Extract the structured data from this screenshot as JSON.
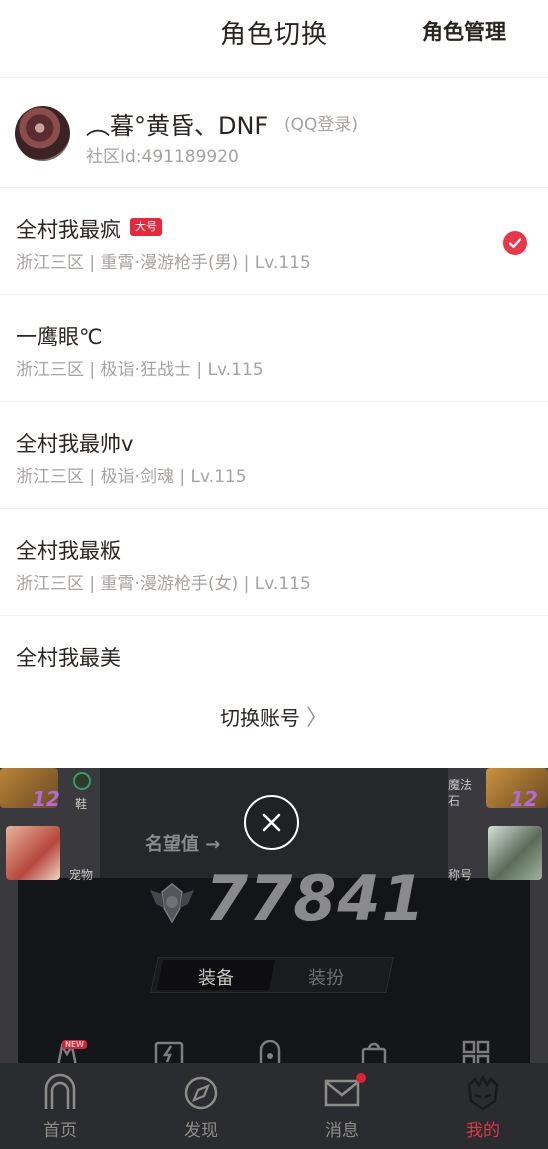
{
  "header": {
    "title": "角色切换",
    "manage_label": "角色管理"
  },
  "account": {
    "name": "︵暮°黄昏、DNF",
    "login_type": "(QQ登录)",
    "community_id": "社区Id:491189920"
  },
  "roles": [
    {
      "name": "全村我最疯",
      "badge": "大号",
      "info": "浙江三区 | 重霄·漫游枪手(男) | Lv.115",
      "selected": true
    },
    {
      "name": "一鹰眼℃",
      "info": "浙江三区 | 极诣·狂战士 | Lv.115",
      "selected": false
    },
    {
      "name": "全村我最帅v",
      "info": "浙江三区 | 极诣·剑魂 | Lv.115",
      "selected": false
    },
    {
      "name": "全村我最粄",
      "info": "浙江三区 | 重霄·漫游枪手(女) | Lv.115",
      "selected": false
    },
    {
      "name": "全村我最美",
      "info": "",
      "selected": false
    }
  ],
  "switch_account": {
    "label": "切换账号"
  },
  "background": {
    "left_level": "12",
    "right_level": "12",
    "shoe_label": "鞋",
    "pet_label": "宠物",
    "magic_stone_label": "魔法\n石",
    "title_label": "称号",
    "fame_label": "名望值 →",
    "fame_value": "77841",
    "tab_equip": "装备",
    "tab_costume": "装扮",
    "new_tag": "NEW"
  },
  "nav": {
    "items": [
      {
        "label": "首页",
        "icon": "home-arch-icon",
        "active": false
      },
      {
        "label": "发现",
        "icon": "compass-icon",
        "active": false
      },
      {
        "label": "消息",
        "icon": "mail-icon",
        "active": false,
        "dot": true
      },
      {
        "label": "我的",
        "icon": "profile-helmet-icon",
        "active": true
      }
    ]
  },
  "colors": {
    "accent": "#e5283a",
    "text": "#2a2522",
    "subtext": "#a6a3a1",
    "nav_bg": "#2b2c30"
  }
}
